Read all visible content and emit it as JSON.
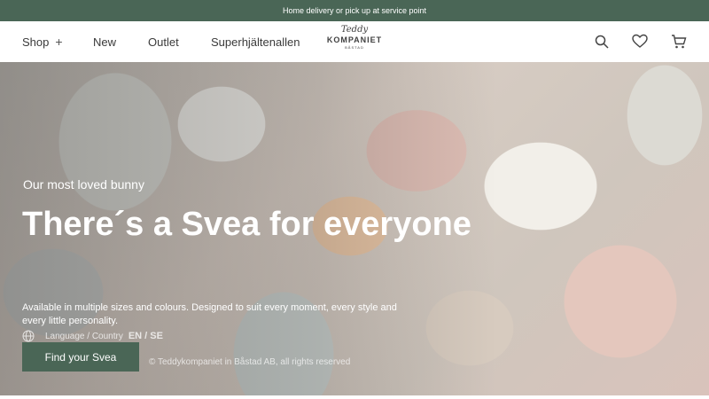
{
  "announcement": "Home delivery or pick up at service point",
  "nav": {
    "shop": "Shop",
    "shop_plus": "+",
    "new": "New",
    "outlet": "Outlet",
    "superheroes": "Superhjältenallen"
  },
  "logo": {
    "line1": "Teddy",
    "line2": "KOMPANIET",
    "line3": "BÅSTAD"
  },
  "icons": [
    "search-icon",
    "heart-icon",
    "cart-icon",
    "globe-icon"
  ],
  "hero": {
    "eyebrow": "Our most loved bunny",
    "headline": "There´s a Svea for everyone",
    "body": "Available in multiple sizes and colours. Designed to suit every moment, every style and every little personality.",
    "cta": "Find your Svea"
  },
  "footer": {
    "language_label": "Language / Country",
    "language_value": "EN / SE",
    "copyright": "© Teddykompaniet in Båstad AB, all rights reserved"
  },
  "colors": {
    "brand_green": "#4a6656",
    "text": "#3a3a3a",
    "white": "#ffffff"
  }
}
